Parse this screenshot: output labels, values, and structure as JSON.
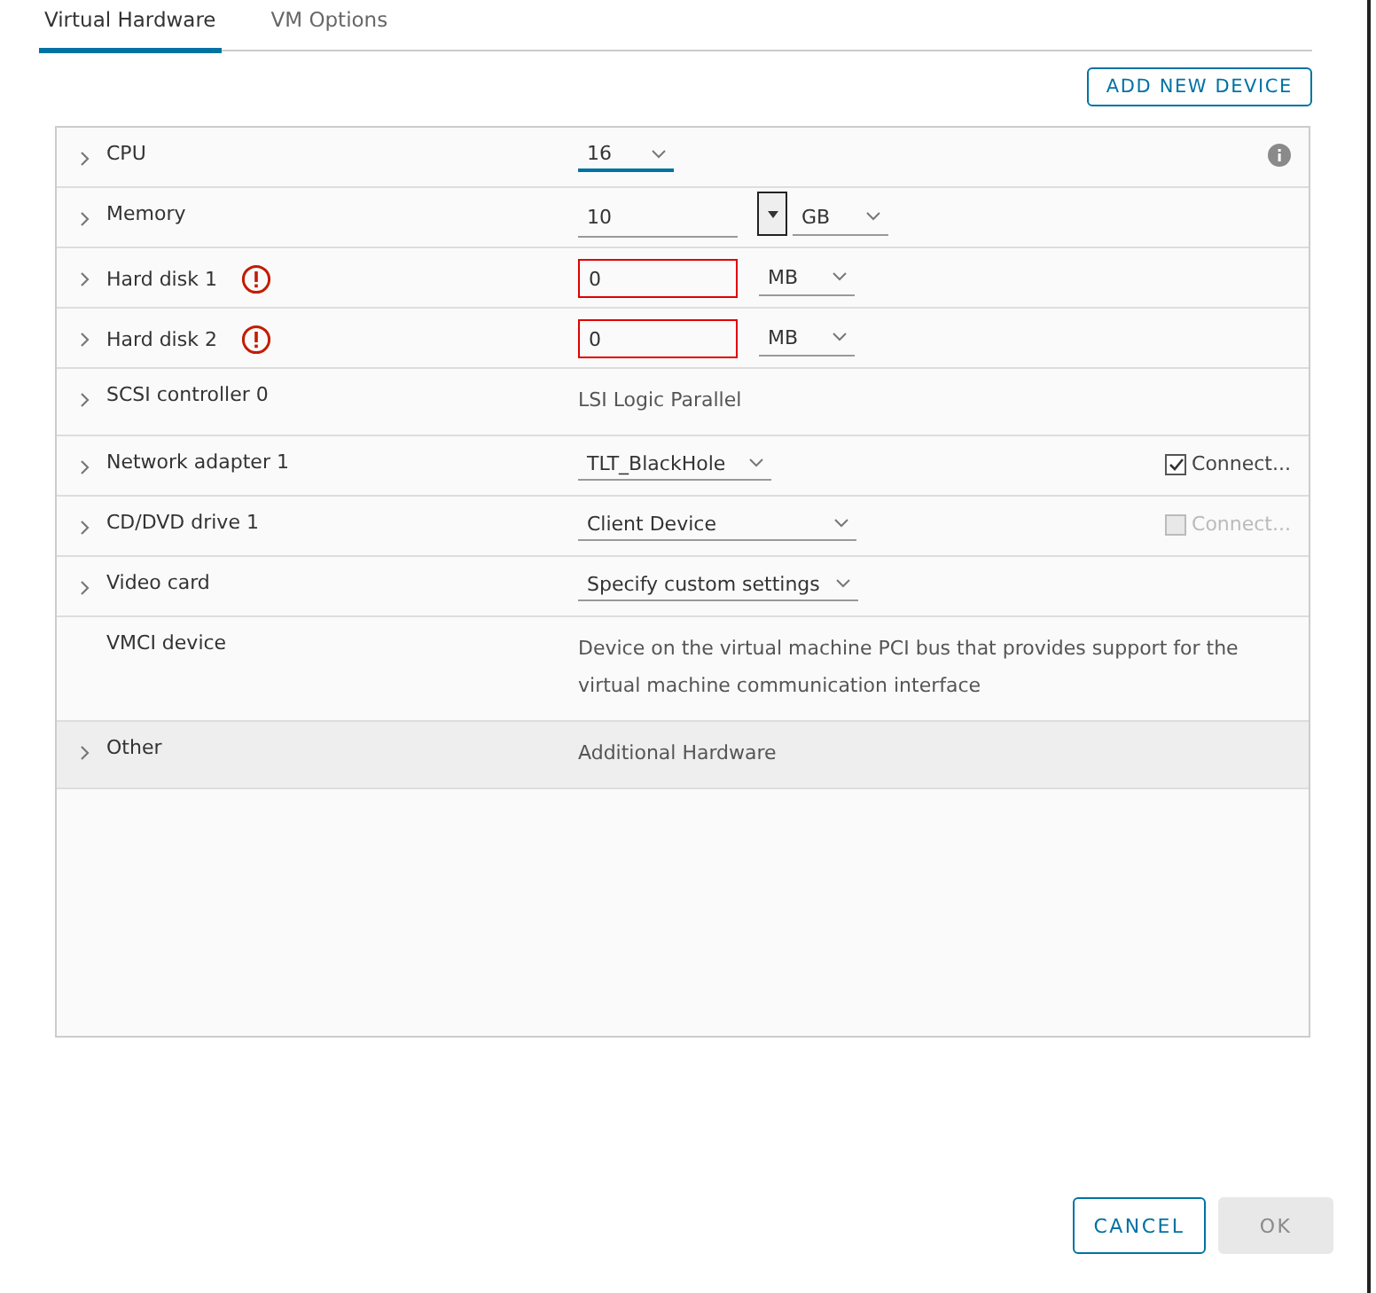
{
  "tabs": [
    {
      "label": "Virtual Hardware",
      "selected": true
    },
    {
      "label": "VM Options",
      "selected": false
    }
  ],
  "add_button": "ADD NEW DEVICE",
  "rows": [
    {
      "kind": "select",
      "label": "CPU",
      "expandable": true,
      "value": "16",
      "focused": true,
      "info": true
    },
    {
      "kind": "number_unit",
      "label": "Memory",
      "expandable": true,
      "value": "10",
      "unit": "GB",
      "spinner": true,
      "error": false
    },
    {
      "kind": "number_unit",
      "label": "Hard disk 1",
      "expandable": true,
      "value": "0",
      "unit": "MB",
      "spinner": false,
      "error": true
    },
    {
      "kind": "number_unit",
      "label": "Hard disk 2",
      "expandable": true,
      "value": "0",
      "unit": "MB",
      "spinner": false,
      "error": true
    },
    {
      "kind": "text",
      "label": "SCSI controller 0",
      "expandable": true,
      "value": "LSI Logic Parallel",
      "highlighted": false
    },
    {
      "kind": "select",
      "label": "Network adapter 1",
      "expandable": true,
      "value": "TLT_BlackHole",
      "focused": false,
      "connect": {
        "label": "Connect...",
        "checked": true,
        "disabled": false
      }
    },
    {
      "kind": "select",
      "label": "CD/DVD drive 1",
      "expandable": true,
      "value": "Client Device",
      "focused": false,
      "connect": {
        "label": "Connect...",
        "checked": false,
        "disabled": true
      }
    },
    {
      "kind": "select",
      "label": "Video card",
      "expandable": true,
      "value": "Specify custom settings",
      "focused": false
    },
    {
      "kind": "text",
      "label": "VMCI device",
      "expandable": false,
      "value": "Device on the virtual machine PCI bus that provides support for the virtual machine communication interface",
      "highlighted": false
    },
    {
      "kind": "text",
      "label": "Other",
      "expandable": true,
      "value": "Additional Hardware",
      "highlighted": true
    }
  ],
  "buttons": [
    {
      "label": "CANCEL",
      "disabled": false
    },
    {
      "label": "OK",
      "disabled": true
    }
  ]
}
